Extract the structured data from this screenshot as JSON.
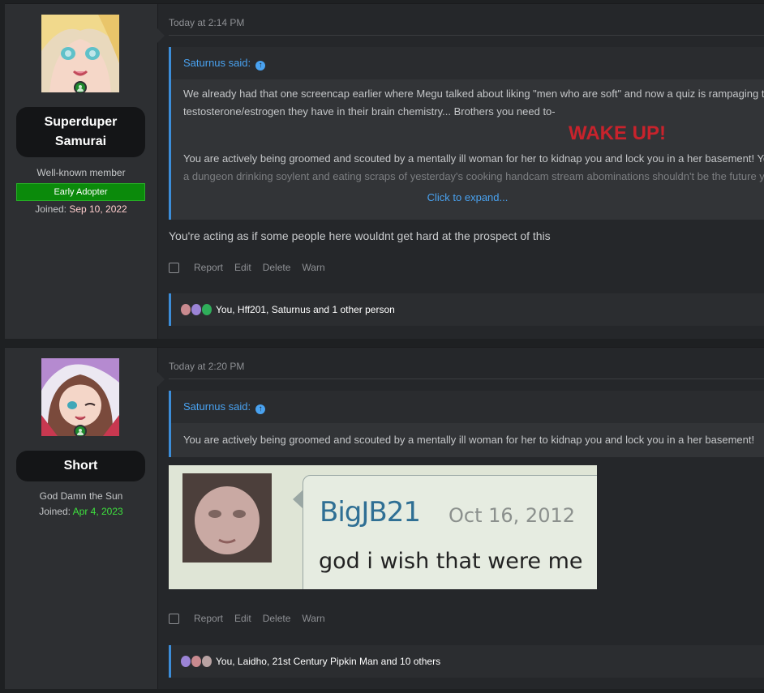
{
  "posts": [
    {
      "user": {
        "name": "Superduper Samurai",
        "title": "Well-known member",
        "banner": "Early Adopter",
        "joined_label": "Joined:",
        "joined_date": "Sep 10, 2022"
      },
      "time": "Today at 2:14 PM",
      "quote": {
        "author": "Saturnus said:",
        "lines": [
          "We already had that one screencap earlier where Megu talked about liking \"men who are soft\" and now a quiz is rampaging through the forum",
          "testosterone/estrogen they have in their brain chemistry... Brothers you need to-",
          "WAKE UP!",
          "You are actively being groomed and scouted by a mentally ill woman for her to kidnap you and lock you in a her basement! You should",
          "a dungeon drinking soylent and eating scraps of yesterday's cooking handcam stream abominations shouldn't be the future you want"
        ],
        "expand": "Click to expand..."
      },
      "message": "You're acting as if some people here wouldnt get hard at the prospect of this",
      "actions": [
        "Report",
        "Edit",
        "Delete",
        "Warn"
      ],
      "reactions": "You, Hff201, Saturnus and 1 other person"
    },
    {
      "user": {
        "name": "Short",
        "title": "God Damn the Sun",
        "joined_label": "Joined:",
        "joined_date": "Apr 4, 2023"
      },
      "time": "Today at 2:20 PM",
      "quote": {
        "author": "Saturnus said:",
        "lines": [
          "You are actively being groomed and scouted by a mentally ill woman for her to kidnap you and lock you in a her basement!"
        ]
      },
      "image": {
        "username": "BigJB21",
        "date": "Oct 16, 2012",
        "text": "god i wish that were me"
      },
      "actions": [
        "Report",
        "Edit",
        "Delete",
        "Warn"
      ],
      "reactions": "You, Laidho, 21st Century Pipkin Man and 10 others"
    }
  ],
  "colors": {
    "accent": "#3c8dd8",
    "link": "#49a2f0",
    "wake": "#c8232c",
    "banner": "#0b8a0b",
    "joined1": "#ffcece",
    "joined2": "#3ee13e"
  },
  "icons": [
    "online-status-icon",
    "quote-jump-icon",
    "reaction-icons",
    "select-checkbox"
  ]
}
